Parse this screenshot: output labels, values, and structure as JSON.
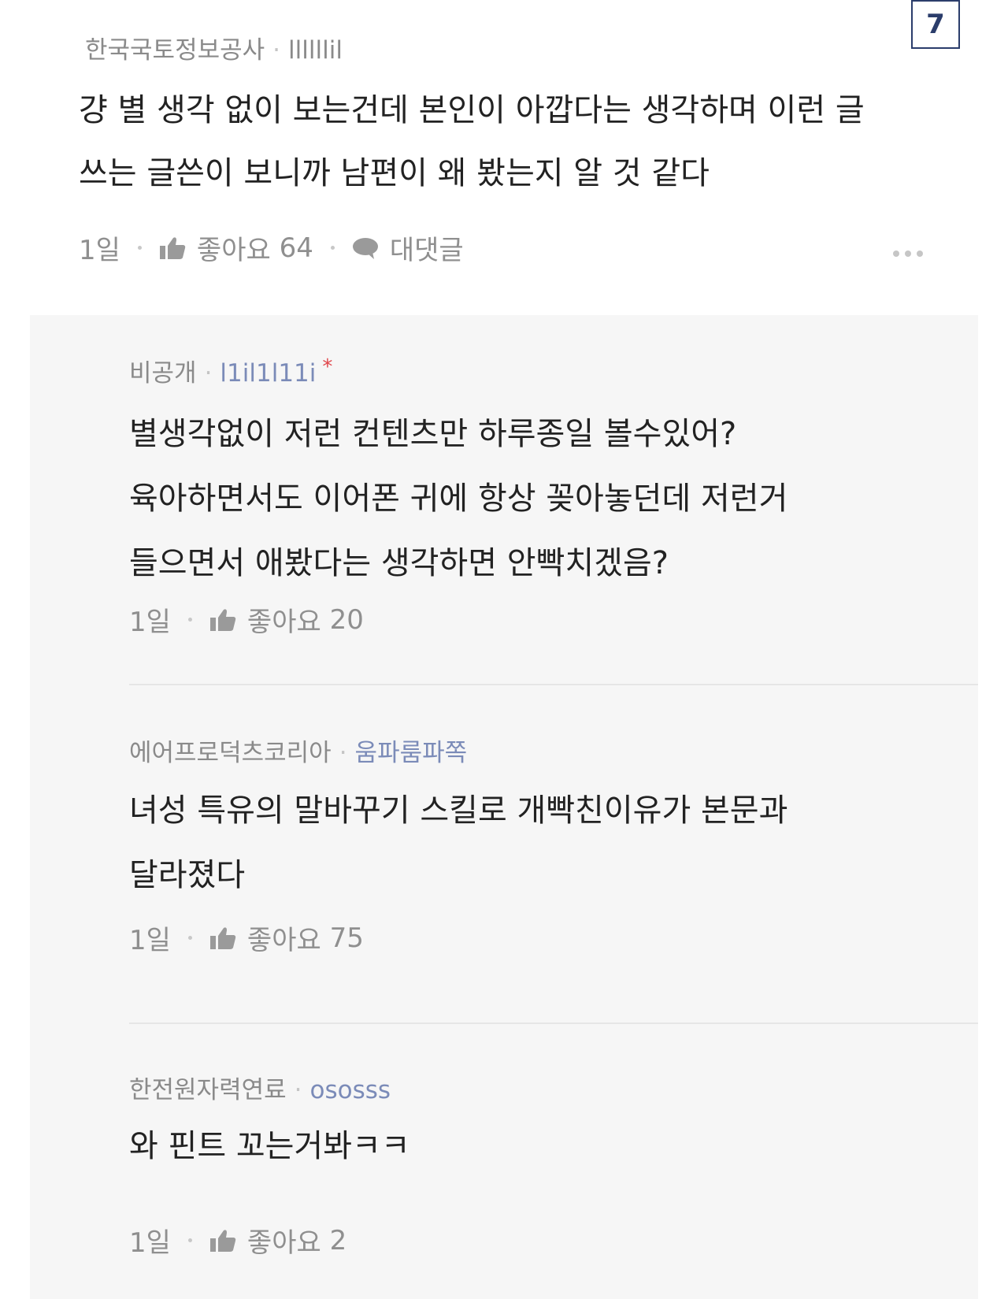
{
  "page_badge": "7",
  "top_comment": {
    "org": "한국국토정보공사",
    "nick": "llllllil",
    "text_line1": "걍 별 생각 없이 보는건데 본인이 아깝다는 생각하며 이런 글",
    "text_line2": "쓰는 글쓴이 보니까 남편이 왜 봤는지 알 것 같다",
    "time": "1일",
    "like_label": "좋아요",
    "like_count": "64",
    "reply_label": "대댓글"
  },
  "replies": [
    {
      "org": "비공개",
      "nick": "l1il1l11i",
      "star": "*",
      "lines": [
        "별생각없이 저런 컨텐츠만 하루종일 볼수있어?",
        "육아하면서도 이어폰 귀에 항상 꽂아놓던데 저런거",
        "들으면서 애봤다는 생각하면 안빡치겠음?"
      ],
      "time": "1일",
      "like_label": "좋아요",
      "like_count": "20"
    },
    {
      "org": "에어프로덕츠코리아",
      "nick": "움파룸파쪽",
      "lines": [
        "녀성 특유의 말바꾸기 스킬로 개빡친이유가 본문과",
        "달라졌다"
      ],
      "time": "1일",
      "like_label": "좋아요",
      "like_count": "75"
    },
    {
      "org": "한전원자력연료",
      "nick": "ososss",
      "lines": [
        "와 핀트 꼬는거봐ㅋㅋ"
      ],
      "time": "1일",
      "like_label": "좋아요",
      "like_count": "2"
    }
  ]
}
